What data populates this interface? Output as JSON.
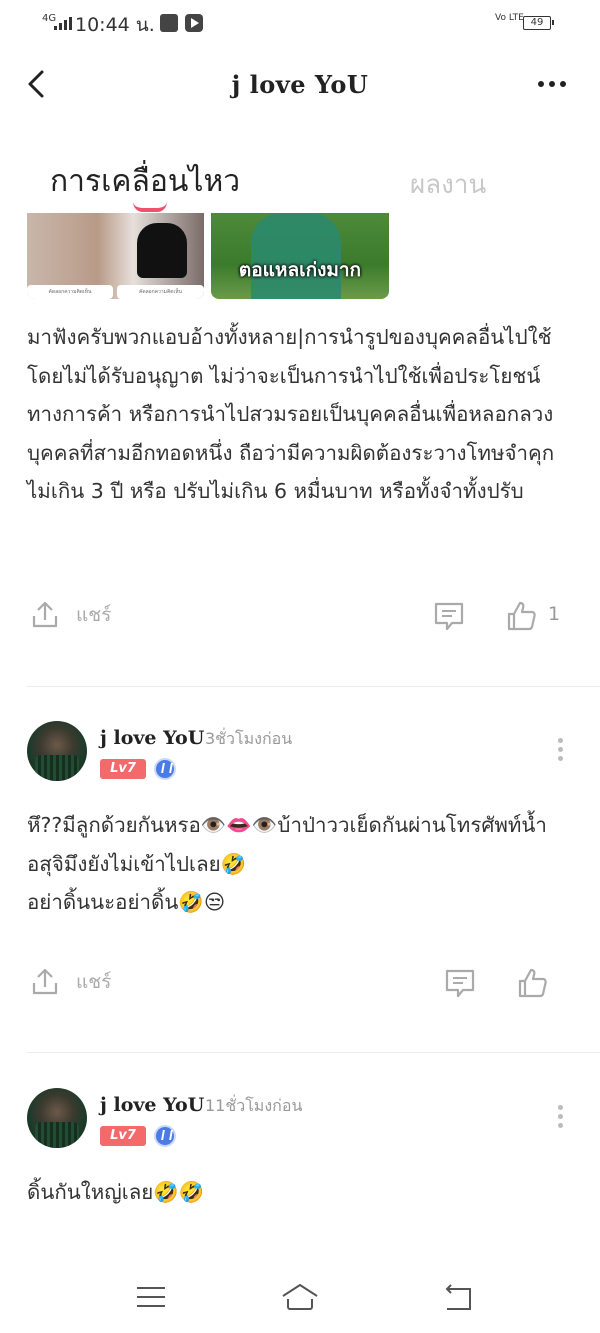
{
  "status_bar": {
    "network": "4G",
    "time": "10:44 น.",
    "volte": "Vo LTE",
    "battery": "49"
  },
  "header": {
    "title": "j love YoU"
  },
  "tabs": {
    "active": "การเคลื่อนไหว",
    "inactive": "ผลงาน"
  },
  "post": {
    "image_caption": "ตอแหลเก่งมาก",
    "image_small_caption_1": "คัดลอกความคิดเห็น",
    "image_small_caption_2": "คัดลอกความคิดเห็น",
    "body": "มาฟังครับพวกแอบอ้างทั้งหลาย|การนำรูปของบุคคลอื่นไปใช้โดยไม่ได้รับอนุญาต ไม่ว่าจะเป็นการนำไปใช้เพื่อประโยชน์ทางการค้า หรือการนำไปสวมรอยเป็นบุคคลอื่นเพื่อหลอกลวงบุคคลที่สามอีกทอดหนึ่ง ถือว่ามีความผิดต้องระวางโทษจำคุกไม่เกิน 3 ปี หรือ ปรับไม่เกิน 6 หมื่นบาท หรือทั้งจำทั้งปรับ",
    "share_label": "แชร์",
    "like_count": "1"
  },
  "comments": [
    {
      "name": "j love YoU",
      "time": "3ชั่วโมงก่อน",
      "level": "Lv7",
      "body": "หึ??มีลูกด้วยกันหรอ👁️👄👁️บ้าป่าววเย็ดกันผ่านโทรศัพท์น้ำอสุจิมึงยังไม่เข้าไปเลย🤣\nอย่าดิ้นนะอย่าดิ้น🤣😒",
      "share_label": "แชร์"
    },
    {
      "name": "j love YoU",
      "time": "11ชั่วโมงก่อน",
      "level": "Lv7",
      "body": "ดิ้นกันใหญ่เลย🤣🤣"
    }
  ],
  "icons": {
    "back": "chevron-left-icon",
    "more": "more-horizontal-icon",
    "share": "share-upload-icon",
    "comment": "comment-icon",
    "like": "thumbs-up-icon",
    "kebab": "more-vertical-icon",
    "nav_menu": "menu-icon",
    "nav_home": "home-icon",
    "nav_back": "back-icon"
  },
  "colors": {
    "accent": "#f0506e",
    "level_badge": "#f46a6a",
    "verify_badge": "#4a7be6",
    "muted_text": "#999999"
  }
}
